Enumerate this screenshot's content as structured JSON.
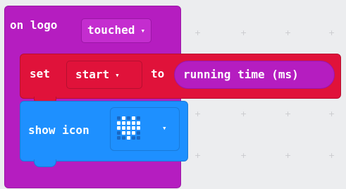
{
  "event": {
    "label": "on logo",
    "action": "touched",
    "caret": "▾"
  },
  "set": {
    "label": "set",
    "variable": "start",
    "caret": "▾",
    "to_label": "to",
    "value": "running time (ms)"
  },
  "show_icon": {
    "label": "show icon",
    "icon_name": "heart-icon",
    "caret": "▾",
    "pattern": [
      [
        0,
        1,
        0,
        1,
        0
      ],
      [
        1,
        1,
        1,
        1,
        1
      ],
      [
        1,
        1,
        1,
        1,
        1
      ],
      [
        0,
        1,
        1,
        1,
        0
      ],
      [
        0,
        0,
        1,
        0,
        0
      ]
    ]
  },
  "grid_dot": "+",
  "colors": {
    "event": "#b51dc0",
    "variables": "#e0123a",
    "basic": "#1e90ff",
    "led_on": "#ffffff",
    "led_off": "#1968c4",
    "workspace": "#ecedef"
  }
}
